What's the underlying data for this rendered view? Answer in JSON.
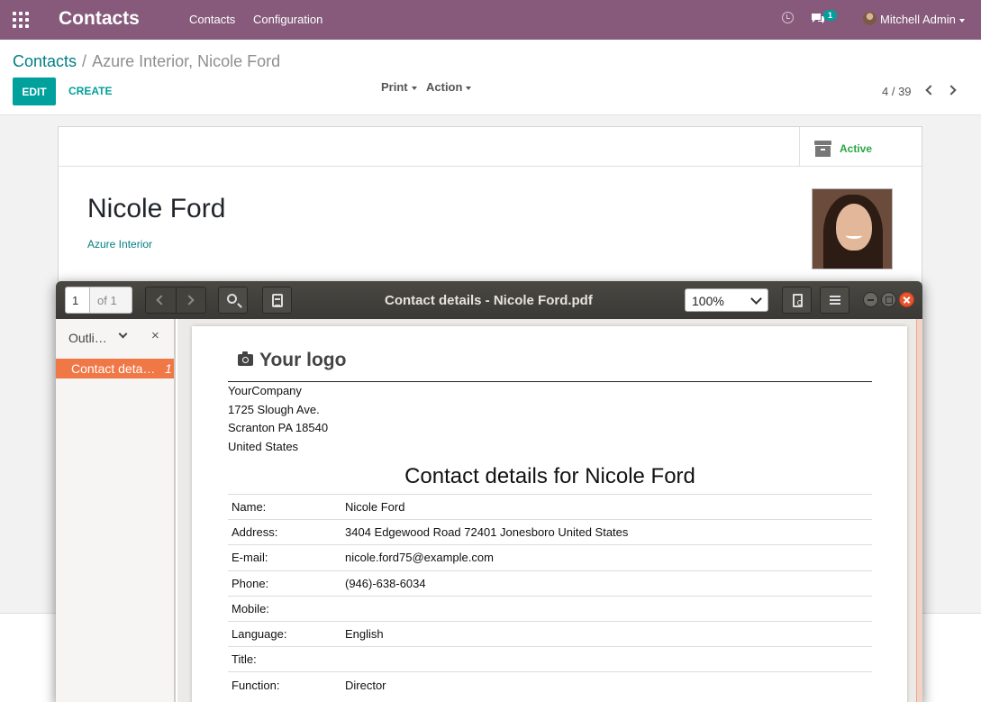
{
  "navbar": {
    "app_name": "Contacts",
    "menu": [
      "Contacts",
      "Configuration"
    ],
    "notification_count": "1",
    "user_name": "Mitchell Admin"
  },
  "control_panel": {
    "breadcrumb_root": "Contacts",
    "breadcrumb_separator": "/",
    "breadcrumb_current": "Azure Interior, Nicole Ford",
    "edit_label": "EDIT",
    "create_label": "CREATE",
    "print_label": "Print",
    "action_label": "Action",
    "pager": "4 / 39"
  },
  "form": {
    "status_label": "Active",
    "name": "Nicole Ford",
    "company": "Azure Interior"
  },
  "pdf_viewer": {
    "page_value": "1",
    "page_of": "of 1",
    "title": "Contact details - Nicole Ford.pdf",
    "zoom": "100%",
    "sidebar_mode": "Outline",
    "sidebar_close": "×",
    "outline_items": [
      {
        "label": "Contact details for Nicole Ford",
        "page": "1"
      }
    ]
  },
  "document": {
    "logo_text": "Your logo",
    "company_lines": [
      "YourCompany",
      "1725 Slough Ave.",
      "Scranton PA 18540",
      "United States"
    ],
    "title": "Contact details for Nicole Ford",
    "rows": [
      {
        "key": "Name:",
        "value": "Nicole Ford"
      },
      {
        "key": "Address:",
        "value": "3404 Edgewood Road 72401 Jonesboro United States"
      },
      {
        "key": "E-mail:",
        "value": "nicole.ford75@example.com"
      },
      {
        "key": "Phone:",
        "value": "(946)-638-6034"
      },
      {
        "key": "Mobile:",
        "value": ""
      },
      {
        "key": "Language:",
        "value": "English"
      },
      {
        "key": "Title:",
        "value": ""
      },
      {
        "key": "Function:",
        "value": "Director"
      }
    ]
  },
  "colors": {
    "navbar": "#875a7b",
    "primary": "#00a09d",
    "link": "#017e84",
    "active_status": "#28a745",
    "outline_selected": "#f07746",
    "window_close": "#e9552f"
  },
  "icons": [
    "apps-grid-icon",
    "clock-icon",
    "chat-icon",
    "archive-icon",
    "search-icon",
    "notes-icon",
    "document-properties-icon",
    "menu-icon",
    "camera-icon"
  ]
}
